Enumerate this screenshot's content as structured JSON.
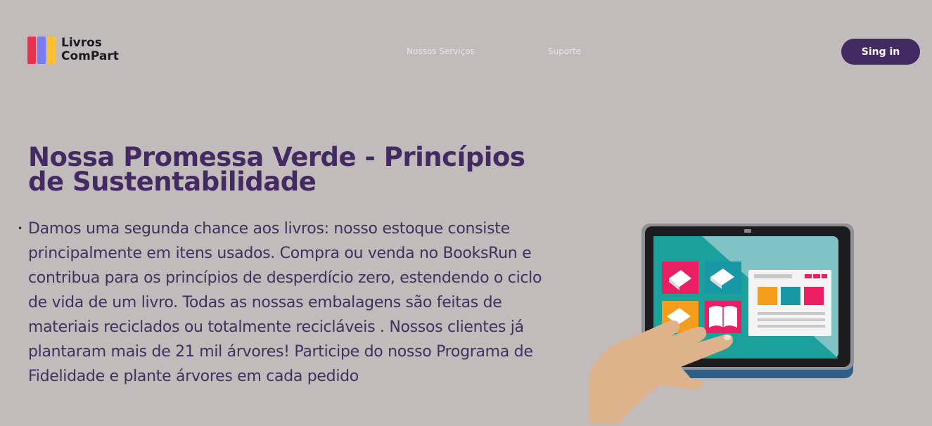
{
  "brand": {
    "line1": "Livros",
    "line2": "ComPart"
  },
  "nav": {
    "services": "Nossos Serviços",
    "support": "Suporte"
  },
  "signin_label": "Sing in",
  "hero": {
    "title": "Nossa Promessa Verde - Princípios de Sustentabilidade",
    "paragraph": "Damos uma segunda chance aos livros: nosso estoque consiste principalmente em itens usados. Compra ou venda no BooksRun e contribua para os princípios de desperdício zero, estendendo o ciclo de vida de um livro. Todas as nossas embalagens são feitas de materiais reciclados ou totalmente recicláveis . Nossos clientes já plantaram mais de 21 mil árvores! Participe do nosso Programa de Fidelidade e plante árvores em cada pedido"
  },
  "colors": {
    "background": "#c1bbbb",
    "accent": "#432a62",
    "logo_red": "#e8304f",
    "logo_purple": "#7b7bf2",
    "logo_yellow": "#ffc02e"
  },
  "icons": {
    "logo": "books-logo-icon",
    "illustration": "tablet-bookstore-illustration"
  }
}
